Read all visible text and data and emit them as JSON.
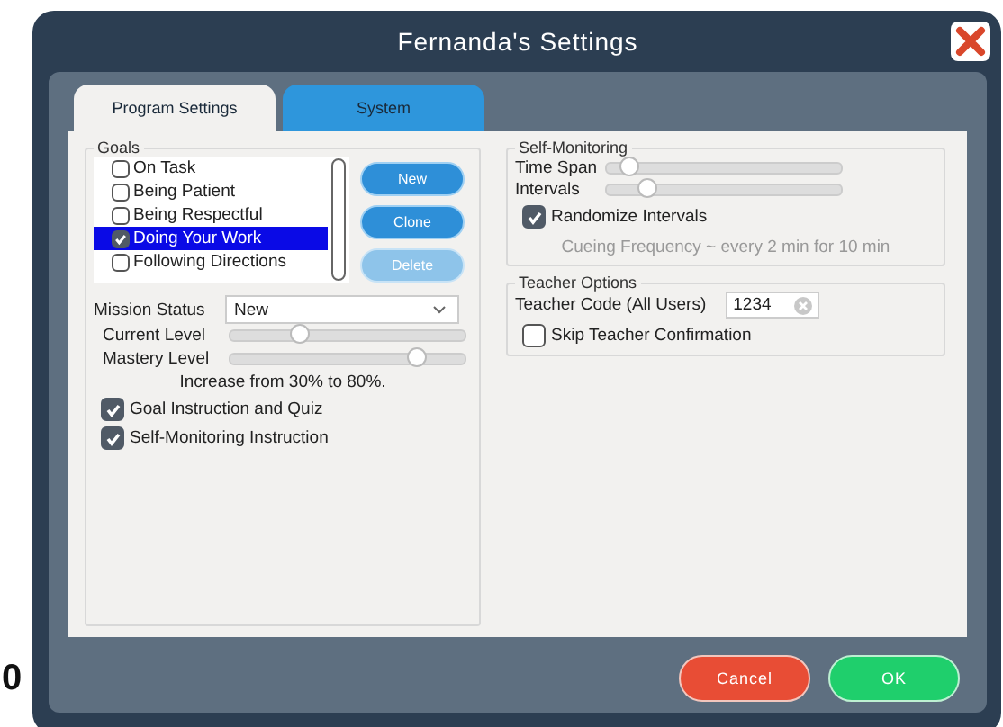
{
  "stray_text": "0",
  "window": {
    "title": "Fernanda's Settings"
  },
  "tabs": [
    {
      "label": "Program Settings",
      "selected": true
    },
    {
      "label": "System",
      "selected": false
    }
  ],
  "goals": {
    "title": "Goals",
    "items": [
      {
        "label": "On Task",
        "checked": false,
        "selected": false
      },
      {
        "label": "Being Patient",
        "checked": false,
        "selected": false
      },
      {
        "label": "Being Respectful",
        "checked": false,
        "selected": false
      },
      {
        "label": "Doing Your Work",
        "checked": true,
        "selected": true
      },
      {
        "label": "Following Directions",
        "checked": false,
        "selected": false
      }
    ],
    "buttons": [
      {
        "label": "New",
        "disabled": false
      },
      {
        "label": "Clone",
        "disabled": false
      },
      {
        "label": "Delete",
        "disabled": true
      }
    ],
    "mission_status": {
      "label": "Mission Status",
      "value": "New"
    },
    "sliders": [
      {
        "label": "Current Level",
        "level": 0.3
      },
      {
        "label": "Mastery Level",
        "level": 0.8
      }
    ],
    "note": "Increase from 30% to 80%.",
    "options": [
      {
        "label": "Goal Instruction and Quiz",
        "checked": true
      },
      {
        "label": "Self-Monitoring Instruction",
        "checked": true
      }
    ]
  },
  "self_monitoring": {
    "title": "Self-Monitoring",
    "sliders": [
      {
        "label": "Time Span",
        "level": 0.1
      },
      {
        "label": "Intervals",
        "level": 0.18
      }
    ],
    "randomize": {
      "label": "Randomize Intervals",
      "checked": true
    },
    "note": "Cueing Frequency ~ every 2 min for 10 min"
  },
  "teacher_options": {
    "title": "Teacher Options",
    "code_label": "Teacher Code (All Users)",
    "code_value": "1234",
    "skip": {
      "label": "Skip Teacher Confirmation",
      "checked": false
    }
  },
  "footer_buttons": [
    {
      "label": "Cancel",
      "kind": "cancel"
    },
    {
      "label": "OK",
      "kind": "ok"
    }
  ]
}
